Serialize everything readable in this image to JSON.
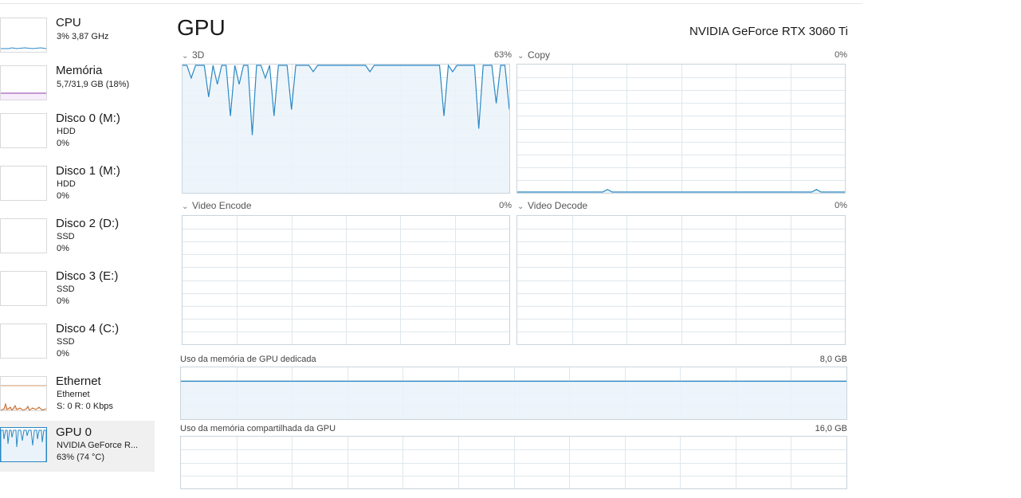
{
  "sidebar": {
    "items": [
      {
        "title": "CPU",
        "line1": "3%  3,87 GHz",
        "line2": ""
      },
      {
        "title": "Memória",
        "line1": "5,7/31,9 GB (18%)",
        "line2": ""
      },
      {
        "title": "Disco 0 (M:)",
        "line1": "HDD",
        "line2": "0%"
      },
      {
        "title": "Disco 1 (M:)",
        "line1": "HDD",
        "line2": "0%"
      },
      {
        "title": "Disco 2 (D:)",
        "line1": "SSD",
        "line2": "0%"
      },
      {
        "title": "Disco 3 (E:)",
        "line1": "SSD",
        "line2": "0%"
      },
      {
        "title": "Disco 4 (C:)",
        "line1": "SSD",
        "line2": "0%"
      },
      {
        "title": "Ethernet",
        "line1": "Ethernet",
        "line2": "S: 0  R: 0 Kbps"
      },
      {
        "title": "GPU 0",
        "line1": "NVIDIA GeForce R...",
        "line2": "63%  (74 °C)"
      }
    ]
  },
  "main": {
    "title": "GPU",
    "gpu_name": "NVIDIA GeForce RTX 3060 Ti",
    "engines": [
      {
        "label": "3D",
        "value": "63%"
      },
      {
        "label": "Copy",
        "value": "0%"
      },
      {
        "label": "Video Encode",
        "value": "0%"
      },
      {
        "label": "Video Decode",
        "value": "0%"
      }
    ],
    "dedicated_memory": {
      "label": "Uso da memória de GPU dedicada",
      "max": "8,0 GB"
    },
    "shared_memory": {
      "label": "Uso da memória compartilhada da GPU",
      "max": "16,0 GB"
    }
  },
  "colors": {
    "gpu_line": "#2b88c4",
    "gpu_fill": "#eaf3fa",
    "grid": "#dfe7ec",
    "memory_line": "#8b2fa8",
    "ethernet_line": "#c06a2b",
    "selected_bg": "#f0f0f0"
  },
  "chart_data": [
    {
      "type": "line",
      "title": "3D",
      "ylim": [
        0,
        100
      ],
      "series": [
        {
          "values": [
            100,
            100,
            90,
            100,
            100,
            100,
            75,
            100,
            85,
            100,
            100,
            60,
            100,
            85,
            100,
            100,
            45,
            100,
            100,
            90,
            100,
            60,
            100,
            100,
            100,
            65,
            100,
            100,
            100,
            100,
            95,
            100,
            100,
            100,
            100,
            100,
            100,
            100,
            100,
            100,
            100,
            100,
            100,
            95,
            100,
            100,
            100,
            100,
            100,
            100,
            100,
            100,
            100,
            100,
            100,
            100,
            100,
            100,
            100,
            100,
            60,
            100,
            95,
            100,
            100,
            100,
            100,
            100,
            50,
            100,
            100,
            100,
            70,
            100,
            100,
            65
          ]
        }
      ]
    },
    {
      "type": "line",
      "title": "Copy",
      "ylim": [
        0,
        100
      ],
      "series": [
        {
          "values": [
            0,
            0,
            0,
            0,
            0,
            0,
            0,
            0,
            0,
            0,
            0,
            0,
            0,
            0,
            0,
            0,
            0,
            0,
            0,
            2,
            0,
            0,
            0,
            0,
            0,
            0,
            0,
            0,
            0,
            0,
            0,
            0,
            0,
            0,
            0,
            0,
            0,
            0,
            0,
            0,
            0,
            0,
            0,
            0,
            0,
            0,
            0,
            0,
            0,
            0,
            0,
            0,
            0,
            0,
            0,
            0,
            0,
            0,
            0,
            0,
            0,
            0,
            0,
            2,
            0,
            0,
            0,
            0,
            0,
            0
          ]
        }
      ]
    },
    {
      "type": "line",
      "title": "Video Encode",
      "ylim": [
        0,
        100
      ],
      "series": [
        {
          "values": [
            0,
            0,
            0,
            0,
            0,
            0,
            0,
            0,
            0,
            0
          ]
        }
      ]
    },
    {
      "type": "line",
      "title": "Video Decode",
      "ylim": [
        0,
        100
      ],
      "series": [
        {
          "values": [
            0,
            0,
            0,
            0,
            0,
            0,
            0,
            0,
            0,
            0
          ]
        }
      ]
    },
    {
      "type": "area",
      "title": "Uso da memória de GPU dedicada",
      "ylim": [
        0,
        8
      ],
      "series": [
        {
          "values": [
            5.9,
            5.9,
            5.9,
            5.9,
            5.9,
            5.9,
            5.9,
            5.9,
            5.9,
            5.9
          ]
        }
      ]
    },
    {
      "type": "area",
      "title": "Uso da memória compartilhada da GPU",
      "ylim": [
        0,
        16
      ],
      "series": [
        {
          "values": [
            0,
            0,
            0,
            0,
            0,
            0,
            0,
            0,
            0,
            0
          ]
        }
      ]
    }
  ]
}
